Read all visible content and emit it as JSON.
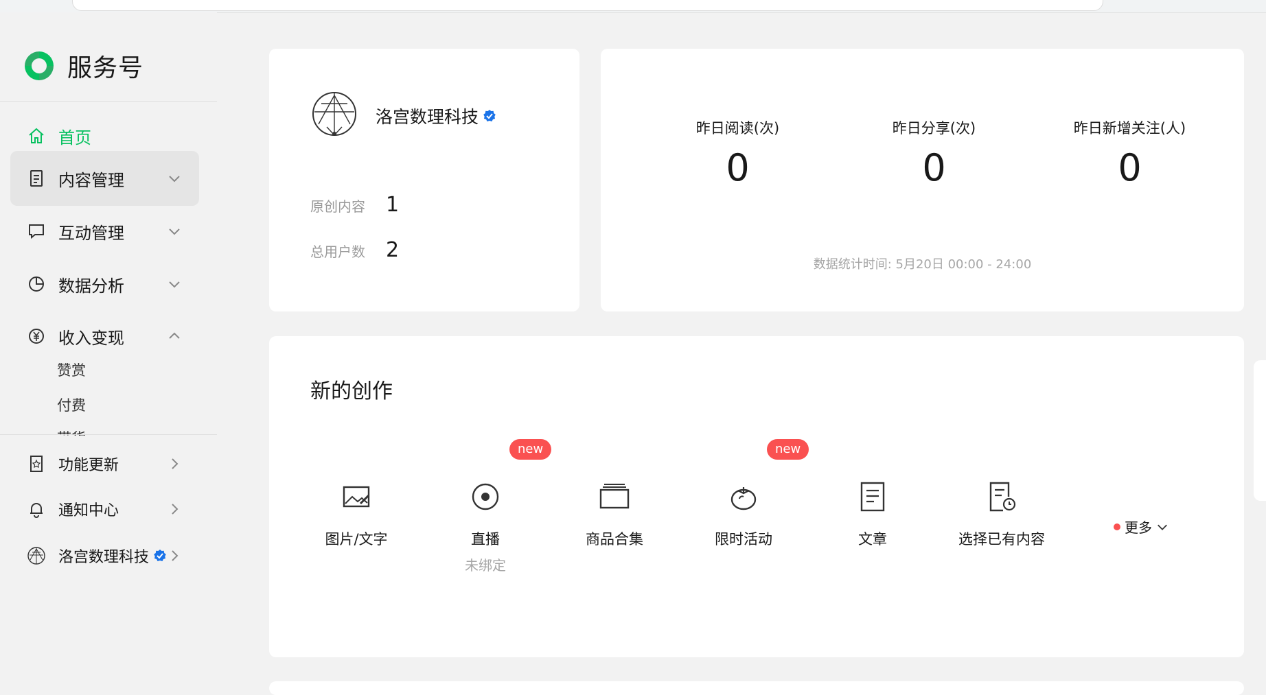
{
  "brand": {
    "title": "服务号",
    "brand_color": "#07c160"
  },
  "sidebar": {
    "items": [
      {
        "label": "首页",
        "icon": "home-icon",
        "active": true
      },
      {
        "label": "内容管理",
        "icon": "document-icon",
        "expanded_bg": true
      },
      {
        "label": "互动管理",
        "icon": "chat-icon"
      },
      {
        "label": "数据分析",
        "icon": "pie-chart-icon"
      },
      {
        "label": "收入变现",
        "icon": "yen-icon"
      }
    ],
    "sub_items": [
      "赞赏",
      "付费",
      "带货"
    ],
    "bottom": [
      {
        "label": "功能更新",
        "icon": "update-icon"
      },
      {
        "label": "通知中心",
        "icon": "bell-icon"
      },
      {
        "label": "洛宫数理科技",
        "icon": "account-avatar-icon"
      }
    ]
  },
  "account": {
    "name": "洛宫数理科技",
    "stats": [
      {
        "label": "原创内容",
        "value": "1"
      },
      {
        "label": "总用户数",
        "value": "2"
      }
    ]
  },
  "metrics": {
    "items": [
      {
        "label": "昨日阅读(次)",
        "value": "0"
      },
      {
        "label": "昨日分享(次)",
        "value": "0"
      },
      {
        "label": "昨日新增关注(人)",
        "value": "0"
      }
    ],
    "time_note": "数据统计时间: 5月20日 00:00 - 24:00"
  },
  "create": {
    "title": "新的创作",
    "badge": "new",
    "items": [
      {
        "label": "图片/文字",
        "icon": "image-text-icon"
      },
      {
        "label": "直播",
        "sub": "未绑定",
        "icon": "live-icon"
      },
      {
        "label": "商品合集",
        "icon": "product-collection-icon"
      },
      {
        "label": "限时活动",
        "icon": "tomato-icon"
      },
      {
        "label": "文章",
        "icon": "article-icon"
      },
      {
        "label": "选择已有内容",
        "icon": "existing-content-icon"
      }
    ],
    "more_label": "更多"
  }
}
